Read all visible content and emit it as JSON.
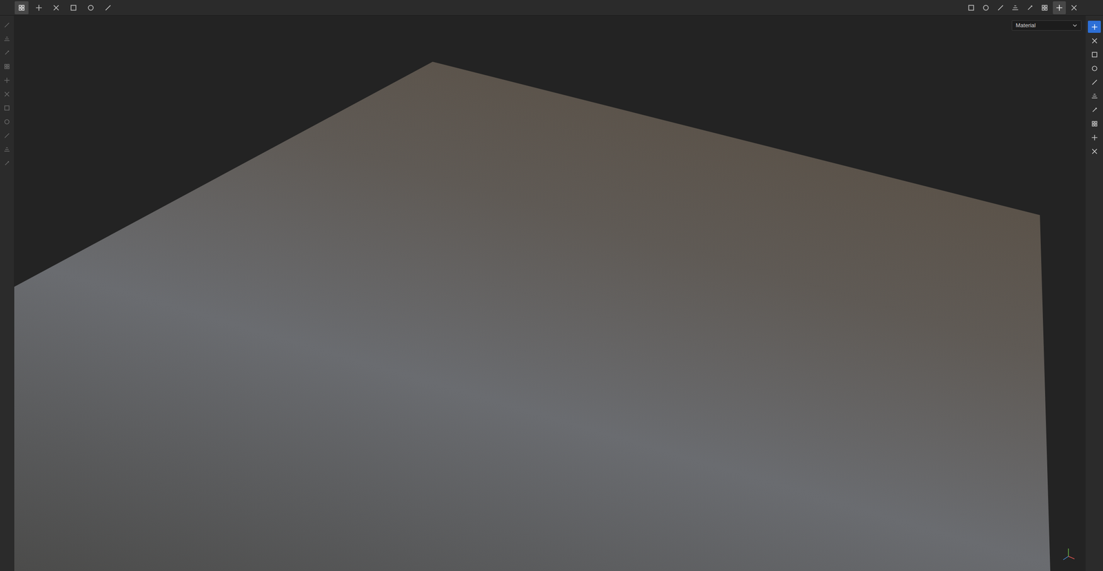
{
  "top_toolbar": {
    "left_tools": [
      {
        "selected": true
      },
      {
        "selected": false
      },
      {
        "selected": false
      },
      {
        "selected": false
      },
      {
        "selected": false
      },
      {
        "selected": false
      }
    ],
    "right_tools": [
      {
        "selected": false
      },
      {
        "selected": false
      },
      {
        "selected": false
      },
      {
        "selected": false
      },
      {
        "selected": false
      },
      {
        "selected": false
      },
      {
        "selected": true
      },
      {
        "selected": false
      }
    ]
  },
  "left_toolbar": {
    "tools": [
      {
        "selected": false
      },
      {
        "selected": false
      },
      {
        "selected": false
      },
      {
        "selected": false
      },
      {
        "selected": false
      },
      {
        "selected": false
      },
      {
        "selected": false
      },
      {
        "selected": false
      },
      {
        "selected": false
      },
      {
        "selected": false
      },
      {
        "selected": false
      }
    ]
  },
  "right_panel_tabs": [
    {
      "selected": true
    },
    {
      "selected": false
    },
    {
      "selected": false
    },
    {
      "selected": false
    },
    {
      "selected": false
    },
    {
      "selected": false
    },
    {
      "selected": false
    },
    {
      "selected": false
    },
    {
      "selected": false
    },
    {
      "selected": false
    }
  ],
  "viewport": {
    "display_mode": "Material"
  }
}
